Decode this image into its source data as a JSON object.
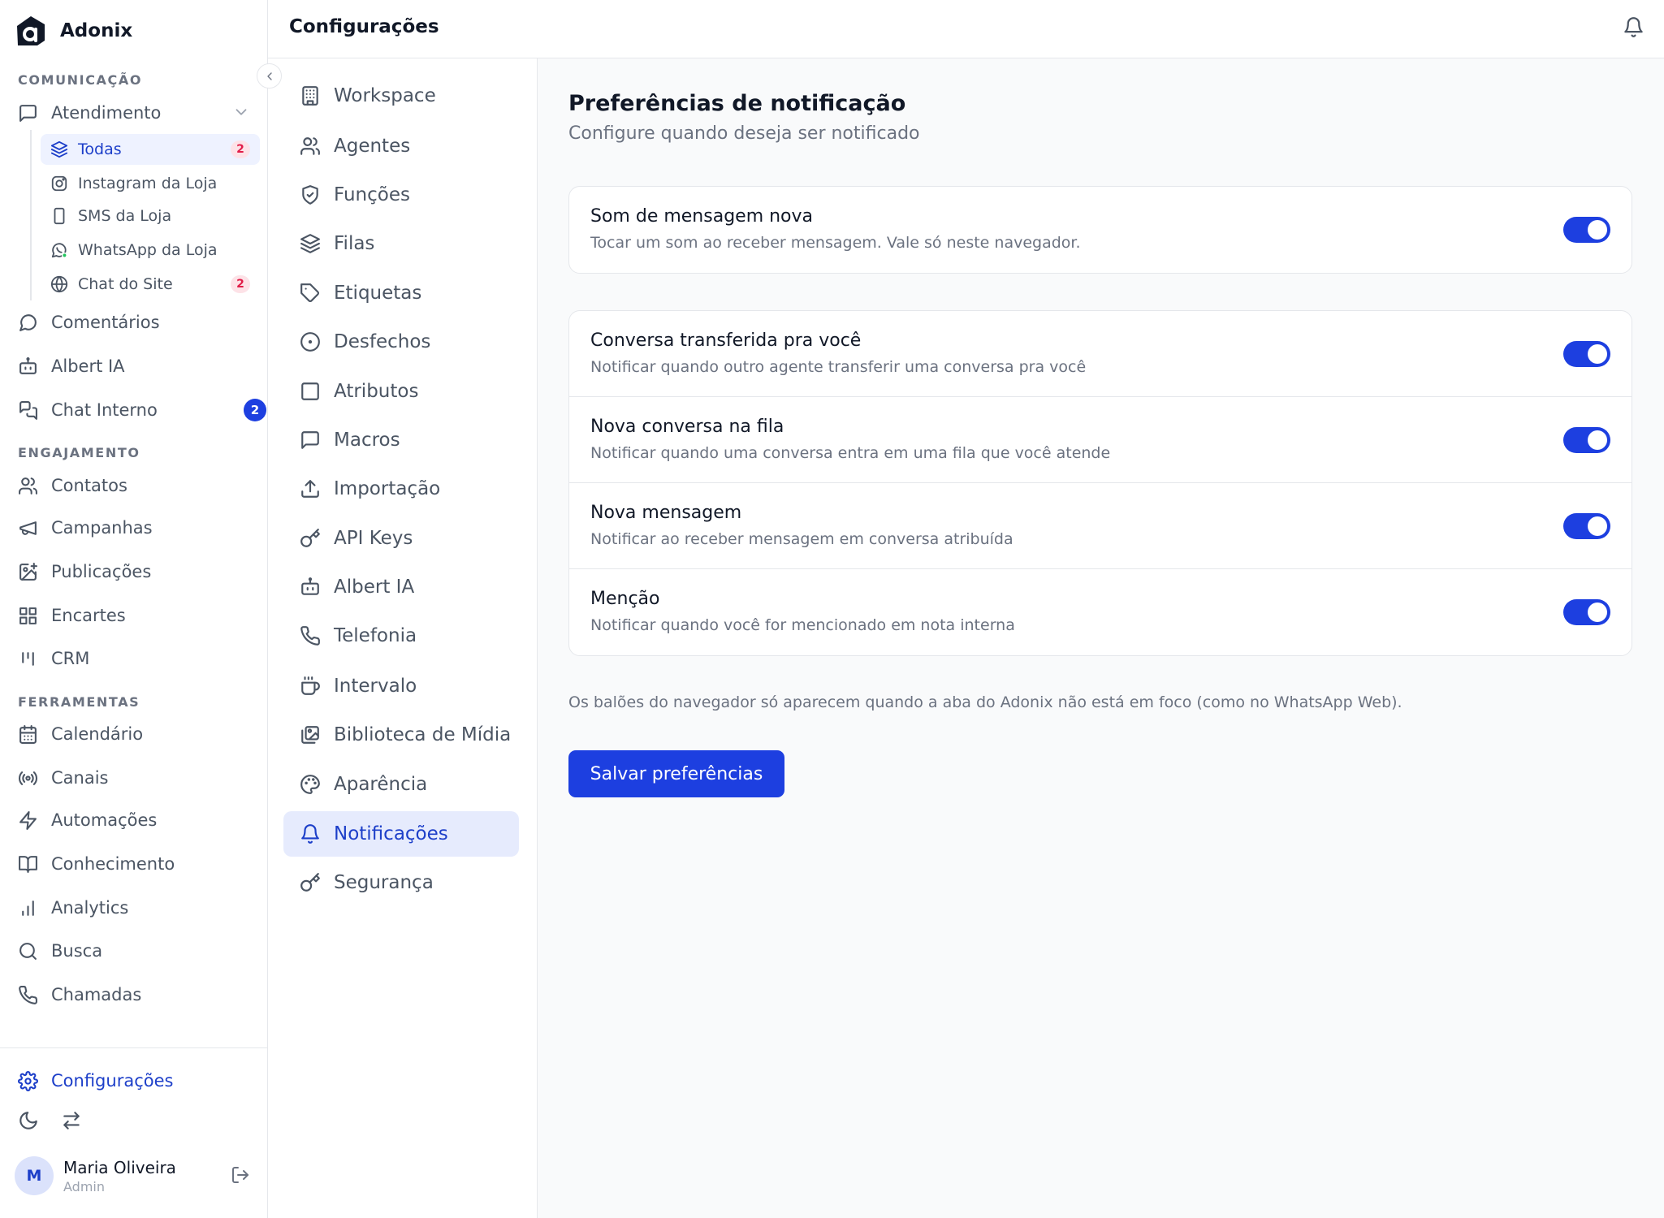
{
  "brand": {
    "name": "Adonix"
  },
  "sidebar": {
    "sections": {
      "comunicacao": "COMUNICAÇÃO",
      "engajamento": "ENGAJAMENTO",
      "ferramentas": "FERRAMENTAS"
    },
    "atendimento": {
      "label": "Atendimento",
      "sub": [
        {
          "label": "Todas",
          "badge": "2",
          "icon": "layers-icon"
        },
        {
          "label": "Instagram da Loja",
          "icon": "instagram-icon"
        },
        {
          "label": "SMS da Loja",
          "icon": "phone-device-icon"
        },
        {
          "label": "WhatsApp da Loja",
          "icon": "whatsapp-icon"
        },
        {
          "label": "Chat do Site",
          "badge": "2",
          "icon": "globe-icon"
        }
      ]
    },
    "comunicacao_items": [
      {
        "label": "Comentários",
        "icon": "comment-icon"
      },
      {
        "label": "Albert IA",
        "icon": "bot-icon"
      },
      {
        "label": "Chat Interno",
        "badge": "2",
        "icon": "chat-bubbles-icon"
      }
    ],
    "engajamento_items": [
      {
        "label": "Contatos",
        "icon": "users-icon"
      },
      {
        "label": "Campanhas",
        "icon": "megaphone-icon"
      },
      {
        "label": "Publicações",
        "icon": "image-plus-icon"
      },
      {
        "label": "Encartes",
        "icon": "grid-icon"
      },
      {
        "label": "CRM",
        "icon": "kanban-icon"
      }
    ],
    "ferramentas_items": [
      {
        "label": "Calendário",
        "icon": "calendar-icon"
      },
      {
        "label": "Canais",
        "icon": "radio-icon"
      },
      {
        "label": "Automações",
        "icon": "zap-icon"
      },
      {
        "label": "Conhecimento",
        "icon": "book-icon"
      },
      {
        "label": "Analytics",
        "icon": "bar-chart-icon"
      },
      {
        "label": "Busca",
        "icon": "search-icon"
      },
      {
        "label": "Chamadas",
        "icon": "phone-icon"
      }
    ],
    "config_label": "Configurações",
    "user": {
      "initial": "M",
      "name": "Maria Oliveira",
      "role": "Admin"
    }
  },
  "header": {
    "title": "Configurações"
  },
  "settings_nav": [
    {
      "label": "Workspace",
      "icon": "building-icon"
    },
    {
      "label": "Agentes",
      "icon": "users-icon"
    },
    {
      "label": "Funções",
      "icon": "shield-check-icon"
    },
    {
      "label": "Filas",
      "icon": "layers-icon"
    },
    {
      "label": "Etiquetas",
      "icon": "tag-icon"
    },
    {
      "label": "Desfechos",
      "icon": "circle-dot-icon"
    },
    {
      "label": "Atributos",
      "icon": "square-icon"
    },
    {
      "label": "Macros",
      "icon": "message-square-icon"
    },
    {
      "label": "Importação",
      "icon": "upload-icon"
    },
    {
      "label": "API Keys",
      "icon": "key-icon"
    },
    {
      "label": "Albert IA",
      "icon": "bot-icon"
    },
    {
      "label": "Telefonia",
      "icon": "phone-icon"
    },
    {
      "label": "Intervalo",
      "icon": "coffee-icon"
    },
    {
      "label": "Biblioteca de Mídia",
      "icon": "images-icon"
    },
    {
      "label": "Aparência",
      "icon": "palette-icon"
    },
    {
      "label": "Notificações",
      "icon": "bell-icon",
      "active": true
    },
    {
      "label": "Segurança",
      "icon": "key-icon"
    }
  ],
  "content": {
    "title": "Preferências de notificação",
    "subtitle": "Configure quando deseja ser notificado",
    "sound_card": [
      {
        "title": "Som de mensagem nova",
        "desc": "Tocar um som ao receber mensagem. Vale só neste navegador.",
        "enabled": true
      }
    ],
    "events_card": [
      {
        "title": "Conversa transferida pra você",
        "desc": "Notificar quando outro agente transferir uma conversa pra você",
        "enabled": true
      },
      {
        "title": "Nova conversa na fila",
        "desc": "Notificar quando uma conversa entra em uma fila que você atende",
        "enabled": true
      },
      {
        "title": "Nova mensagem",
        "desc": "Notificar ao receber mensagem em conversa atribuída",
        "enabled": true
      },
      {
        "title": "Menção",
        "desc": "Notificar quando você for mencionado em nota interna",
        "enabled": true
      }
    ],
    "note": "Os balões do navegador só aparecem quando a aba do Adonix não está em foco (como no WhatsApp Web).",
    "save_label": "Salvar preferências"
  },
  "colors": {
    "accent": "#1d3fe0",
    "accent_text": "#1d3fc9",
    "badge_pink_bg": "#fde2e7",
    "badge_pink_text": "#e11d48"
  }
}
